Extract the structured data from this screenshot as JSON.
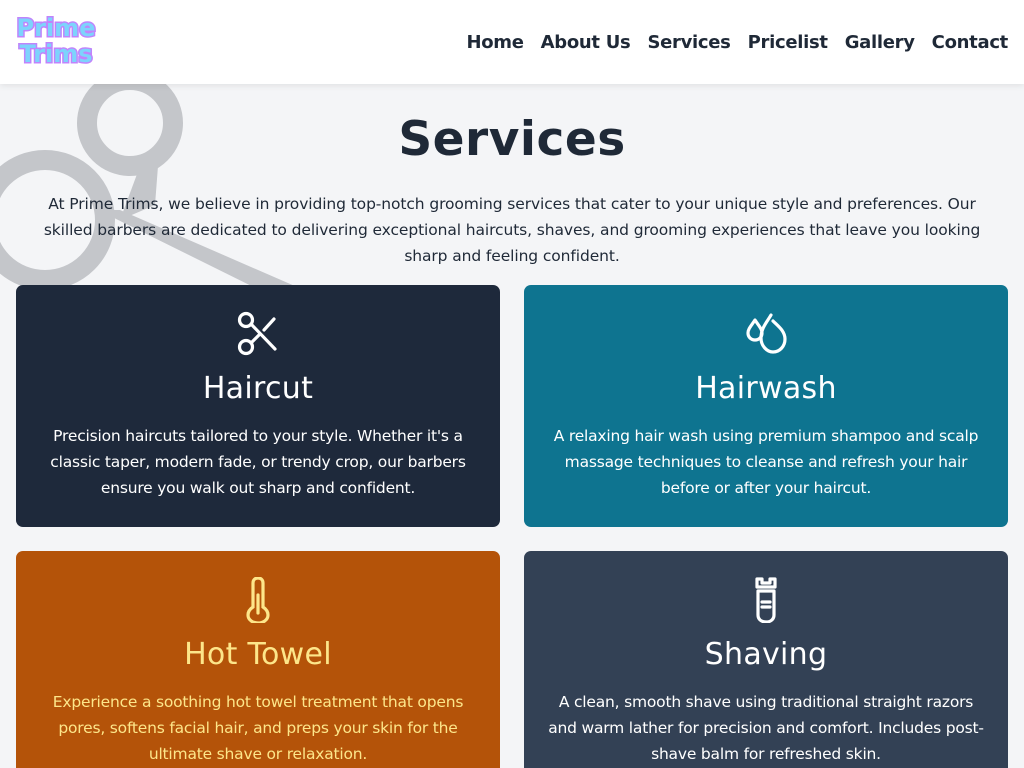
{
  "brand": {
    "line1": "Prime",
    "line2": "Trims"
  },
  "nav": {
    "items": [
      {
        "label": "Home"
      },
      {
        "label": "About Us"
      },
      {
        "label": "Services"
      },
      {
        "label": "Pricelist"
      },
      {
        "label": "Gallery"
      },
      {
        "label": "Contact"
      }
    ]
  },
  "services": {
    "title": "Services",
    "intro": "At Prime Trims, we believe in providing top-notch grooming services that cater to your unique style and preferences. Our skilled barbers are dedicated to delivering exceptional haircuts, shaves, and grooming experiences that leave you looking sharp and feeling confident.",
    "cards": [
      {
        "title": "Haircut",
        "text": "Precision haircuts tailored to your style. Whether it's a classic taper, modern fade, or trendy crop, our barbers ensure you walk out sharp and confident.",
        "icon": "scissors-icon",
        "color": "#1e293b"
      },
      {
        "title": "Hairwash",
        "text": "A relaxing hair wash using premium shampoo and scalp massage techniques to cleanse and refresh your hair before or after your haircut.",
        "icon": "droplets-icon",
        "color": "#0e7490"
      },
      {
        "title": "Hot Towel",
        "text": "Experience a soothing hot towel treatment that opens pores, softens facial hair, and preps your skin for the ultimate shave or relaxation.",
        "icon": "thermometer-icon",
        "color": "#b45309"
      },
      {
        "title": "Shaving",
        "text": "A clean, smooth shave using traditional straight razors and warm lather for precision and comfort. Includes post-shave balm for refreshed skin.",
        "icon": "razor-icon",
        "color": "#334155"
      }
    ]
  },
  "colors": {
    "header_bg": "#ffffff",
    "page_bg": "#f4f5f7",
    "logo_fill": "#7dd3fc",
    "logo_outline": "#c084fc"
  }
}
